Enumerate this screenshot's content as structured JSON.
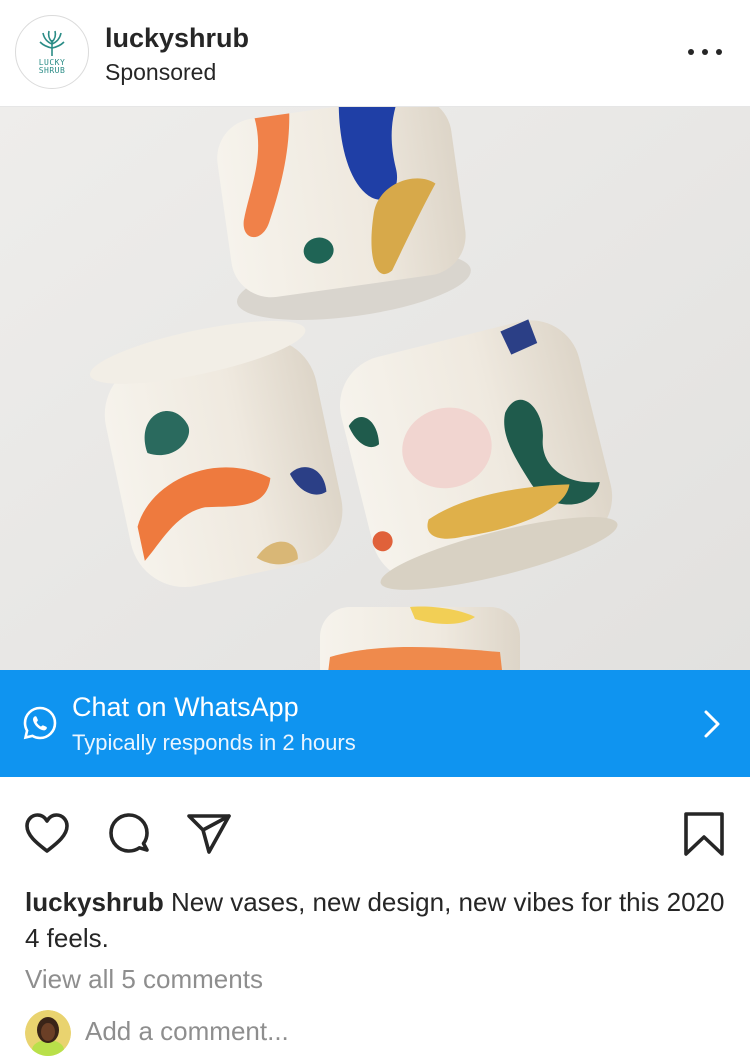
{
  "header": {
    "username": "luckyshrub",
    "subtitle": "Sponsored",
    "logo_text": "LUCKY SHRUB",
    "more_icon": "more-horizontal-icon"
  },
  "post": {
    "image_description_icon": "ceramic-cups-photo"
  },
  "cta": {
    "title": "Chat on WhatsApp",
    "subtitle": "Typically responds in 2 hours",
    "icon": "whatsapp-icon",
    "chevron": "chevron-right-icon",
    "color": "#0f94f0"
  },
  "actions": {
    "like_icon": "heart-icon",
    "comment_icon": "comment-icon",
    "share_icon": "send-icon",
    "save_icon": "bookmark-icon"
  },
  "caption": {
    "username": "luckyshrub",
    "text": "New vases, new design, new vibes for this 2020 4 feels."
  },
  "comments": {
    "view_all": "View all 5 comments",
    "add_placeholder": "Add a comment..."
  }
}
